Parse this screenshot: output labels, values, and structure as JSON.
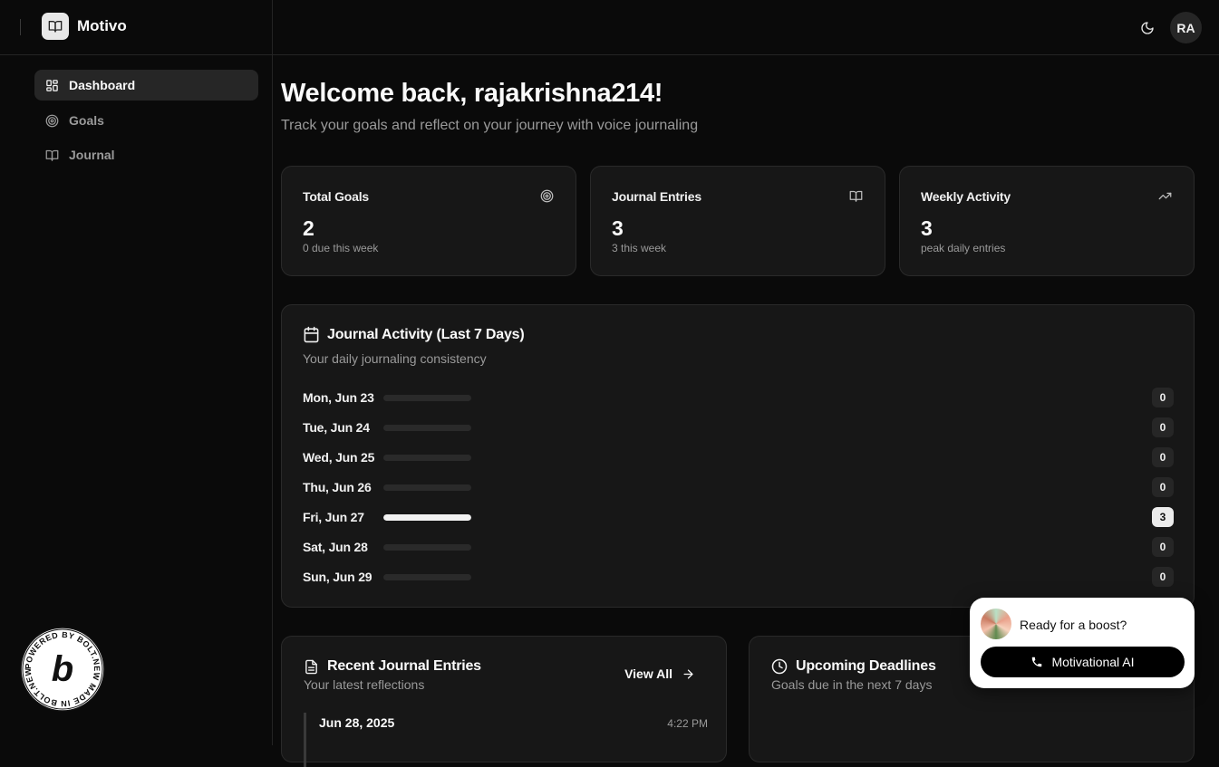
{
  "app": {
    "name": "Motivo",
    "avatar_initials": "RA"
  },
  "sidebar": {
    "items": [
      {
        "label": "Dashboard",
        "icon": "layout-dashboard-icon",
        "active": true
      },
      {
        "label": "Goals",
        "icon": "target-icon",
        "active": false
      },
      {
        "label": "Journal",
        "icon": "book-open-icon",
        "active": false
      }
    ],
    "badge_text": "POWERED BY BOLT.NEW MADE IN BOLT.NEW"
  },
  "header": {
    "welcome": "Welcome back, rajakrishna214!",
    "subtitle": "Track your goals and reflect on your journey with voice journaling"
  },
  "stats": [
    {
      "title": "Total Goals",
      "value": "2",
      "sub": "0 due this week",
      "icon": "target-icon"
    },
    {
      "title": "Journal Entries",
      "value": "3",
      "sub": "3 this week",
      "icon": "book-open-icon"
    },
    {
      "title": "Weekly Activity",
      "value": "3",
      "sub": "peak daily entries",
      "icon": "trending-up-icon"
    }
  ],
  "activity": {
    "title": "Journal Activity (Last 7 Days)",
    "subtitle": "Your daily journaling consistency",
    "max": 3,
    "days": [
      {
        "label": "Mon, Jun 23",
        "count": "0",
        "fraction": 0
      },
      {
        "label": "Tue, Jun 24",
        "count": "0",
        "fraction": 0
      },
      {
        "label": "Wed, Jun 25",
        "count": "0",
        "fraction": 0
      },
      {
        "label": "Thu, Jun 26",
        "count": "0",
        "fraction": 0
      },
      {
        "label": "Fri, Jun 27",
        "count": "3",
        "fraction": 1
      },
      {
        "label": "Sat, Jun 28",
        "count": "0",
        "fraction": 0
      },
      {
        "label": "Sun, Jun 29",
        "count": "0",
        "fraction": 0
      }
    ]
  },
  "recent": {
    "title": "Recent Journal Entries",
    "subtitle": "Your latest reflections",
    "view_all": "View All",
    "entry": {
      "date": "Jun 28, 2025",
      "time": "4:22 PM"
    }
  },
  "deadlines": {
    "title": "Upcoming Deadlines",
    "subtitle": "Goals due in the next 7 days"
  },
  "boost": {
    "prompt": "Ready for a boost?",
    "button": "Motivational AI"
  }
}
